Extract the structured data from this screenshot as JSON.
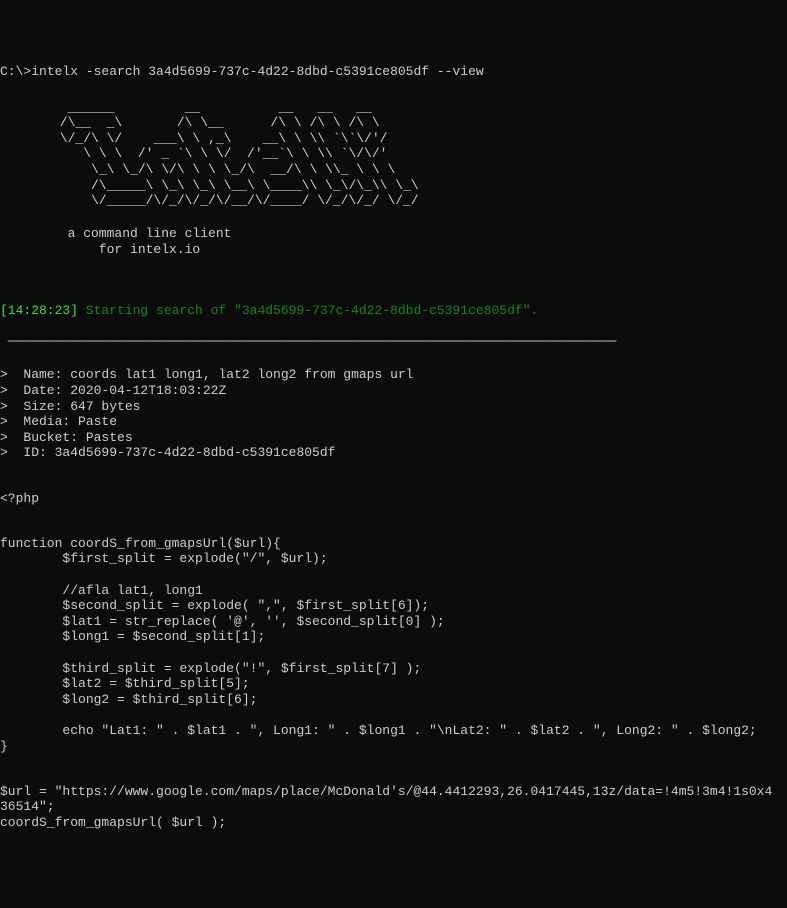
{
  "prompt": {
    "path": "C:\\>",
    "command": "intelx -search 3a4d5699-737c-4d22-8dbd-c5391ce805df --view"
  },
  "ascii_art": "  ______         __          __   __   __\n /\\__  _\\       /\\ \\__      /\\ \\ /\\ \\ /\\ \\\n \\/_/\\ \\/    ___\\ \\ ,_\\    __\\ \\ \\\\ `\\`\\/'/\n    \\ \\ \\  /' _ `\\ \\ \\/  /'__`\\ \\ \\\\ `\\/\\/'\n     \\_\\ \\_/\\ \\/\\ \\ \\ \\_/\\  __/\\ \\ \\\\_ \\ \\ \\\n     /\\_____\\ \\_\\ \\_\\ \\__\\ \\____\\\\ \\_\\/\\_\\\\ \\_\\\n     \\/_____/\\/_/\\/_/\\/__/\\/____/ \\/_/\\/_/ \\/_/",
  "tagline": {
    "line1": "  a command line client",
    "line2": "      for intelx.io"
  },
  "status": {
    "timestamp": "[14:28:23]",
    "text": " Starting search of \"3a4d5699-737c-4d22-8dbd-c5391ce805df\"."
  },
  "separator_line": " ──────────────────────────────────────────────────────────────────────────────",
  "meta": {
    "name": {
      "label": ">  Name: ",
      "value": "coords lat1 long1, lat2 long2 from gmaps url"
    },
    "date": {
      "label": ">  Date: ",
      "value": "2020-04-12T18:03:22Z"
    },
    "size": {
      "label": ">  Size: ",
      "value": "647 bytes"
    },
    "media": {
      "label": ">  Media: ",
      "value": "Paste"
    },
    "bucket": {
      "label": ">  Bucket: ",
      "value": "Pastes"
    },
    "id": {
      "label": ">  ID: ",
      "value": "3a4d5699-737c-4d22-8dbd-c5391ce805df"
    }
  },
  "code": {
    "line1": "<?php",
    "block1": "function coordS_from_gmapsUrl($url){\n        $first_split = explode(\"/\", $url);\n\n        //afla lat1, long1\n        $second_split = explode( \",\", $first_split[6]);\n        $lat1 = str_replace( '@', '', $second_split[0] );\n        $long1 = $second_split[1];\n\n        $third_split = explode(\"!\", $first_split[7] );\n        $lat2 = $third_split[5];\n        $long2 = $third_split[6];\n\n        echo \"Lat1: \" . $lat1 . \", Long1: \" . $long1 . \"\\nLat2: \" . $lat2 . \", Long2: \" . $long2;\n}",
    "block2": "$url = \"https://www.google.com/maps/place/McDonald's/@44.4412293,26.0417445,13z/data=!4m5!3m4!1s0x4\n36514\";\ncoordS_from_gmapsUrl( $url );"
  }
}
